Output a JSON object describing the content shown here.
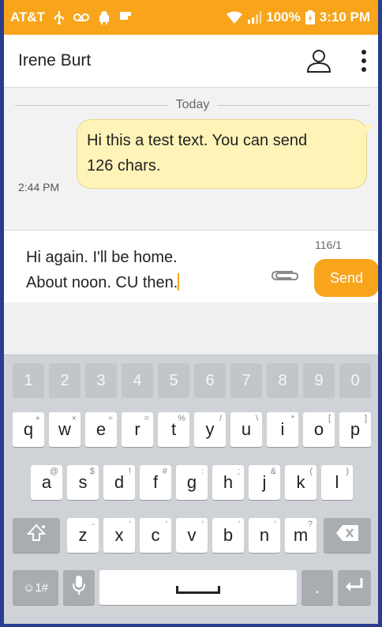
{
  "status_bar": {
    "carrier": "AT&T",
    "battery": "100%",
    "time": "3:10 PM",
    "icons": [
      "usb-icon",
      "voicemail-icon",
      "android-icon",
      "flipboard-icon",
      "wifi-icon",
      "signal-icon",
      "battery-icon"
    ]
  },
  "header": {
    "contact_name": "Irene Burt",
    "contact_icon": "person-icon",
    "menu_icon": "more-vert-icon"
  },
  "conversation": {
    "date_separator": "Today",
    "messages": [
      {
        "line1": "Hi this a test text.  You can send",
        "line2": "126 chars.",
        "time": "2:44 PM"
      }
    ]
  },
  "compose": {
    "line1": "Hi again. I'll be home.",
    "line2": "About noon. CU then.",
    "counter": "116/1",
    "attach_icon": "paperclip-icon",
    "send_label": "Send"
  },
  "keyboard": {
    "numbers": [
      "1",
      "2",
      "3",
      "4",
      "5",
      "6",
      "7",
      "8",
      "9",
      "0"
    ],
    "row1": [
      {
        "key": "q",
        "hint": "+"
      },
      {
        "key": "w",
        "hint": "×"
      },
      {
        "key": "e",
        "hint": "÷"
      },
      {
        "key": "r",
        "hint": "="
      },
      {
        "key": "t",
        "hint": "%"
      },
      {
        "key": "y",
        "hint": "/"
      },
      {
        "key": "u",
        "hint": "\\"
      },
      {
        "key": "i",
        "hint": "*"
      },
      {
        "key": "o",
        "hint": "["
      },
      {
        "key": "p",
        "hint": "]"
      }
    ],
    "row2": [
      {
        "key": "a",
        "hint": "@"
      },
      {
        "key": "s",
        "hint": "$"
      },
      {
        "key": "d",
        "hint": "!"
      },
      {
        "key": "f",
        "hint": "#"
      },
      {
        "key": "g",
        "hint": ":"
      },
      {
        "key": "h",
        "hint": ";"
      },
      {
        "key": "j",
        "hint": "&"
      },
      {
        "key": "k",
        "hint": "("
      },
      {
        "key": "l",
        "hint": ")"
      }
    ],
    "row3": [
      {
        "key": "z",
        "hint": "-"
      },
      {
        "key": "x",
        "hint": "'"
      },
      {
        "key": "c",
        "hint": "'"
      },
      {
        "key": "v",
        "hint": "'"
      },
      {
        "key": "b",
        "hint": "'"
      },
      {
        "key": "n",
        "hint": "'"
      },
      {
        "key": "m",
        "hint": "?"
      }
    ],
    "symbols_label": "☺1#",
    "period_label": ".",
    "shift_icon": "shift-icon",
    "backspace_icon": "backspace-icon",
    "mic_icon": "mic-icon",
    "enter_icon": "enter-icon",
    "space_icon": "space-icon"
  },
  "colors": {
    "accent": "#f8a51b",
    "bubble": "#fff3b8",
    "frame": "#2a3c8f"
  }
}
